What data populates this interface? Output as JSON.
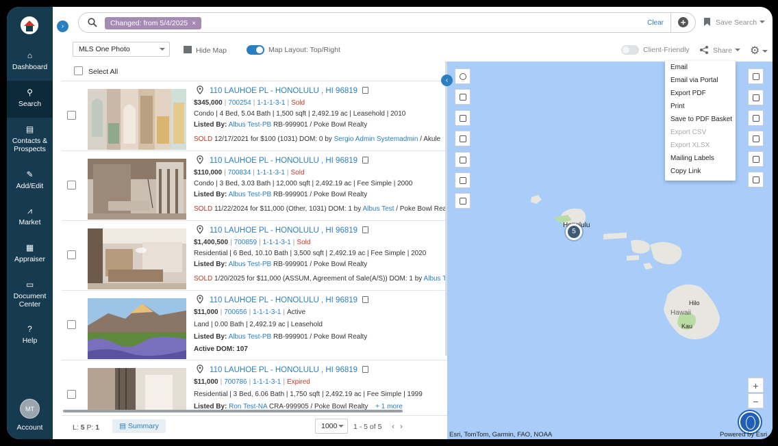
{
  "sidebar": {
    "items": [
      {
        "label": "Dashboard",
        "icon": "home-icon"
      },
      {
        "label": "Search",
        "icon": "search-icon"
      },
      {
        "label": "Contacts & Prospects",
        "icon": "contact-card-icon"
      },
      {
        "label": "Add/Edit",
        "icon": "edit-icon"
      },
      {
        "label": "Market",
        "icon": "chart-icon"
      },
      {
        "label": "Appraiser",
        "icon": "calculator-icon"
      },
      {
        "label": "Document Center",
        "icon": "folder-icon"
      },
      {
        "label": "Help",
        "icon": "help-icon"
      }
    ],
    "account_initials": "MT",
    "account_label": "Account"
  },
  "search": {
    "chip": "Changed: from 5/4/2025",
    "clear": "Clear",
    "save_search": "Save Search"
  },
  "toolbar": {
    "view_select": "MLS One Photo",
    "hide_map": "Hide Map",
    "map_layout": "Map Layout: Top/Right",
    "client_friendly": "Client-Friendly",
    "share": "Share"
  },
  "list": {
    "select_all": "Select All",
    "rows": [
      {
        "address": "110 LAUHOE PL - HONOLULU , HI 96819",
        "price": "$345,000",
        "mls": "700254",
        "tmk": "1-1-1-3-1",
        "status": "Sold",
        "details": "Condo | 4  Bed, 5.04 Bath | 1,500 sqft | 2,492.19 ac | Leasehold | 2010",
        "listed_by_label": "Listed By:",
        "agent": "Albus Test-PB",
        "agent_rest": "RB-999901 / Poke Bowl Realty",
        "sold_label": "SOLD",
        "sold_rest": "12/17/2021 for $100 (1031) DOM: 0 by",
        "buyer_agent": "Sergio Admin Systemadmin",
        "buyer_rest": "/ Akule"
      },
      {
        "address": "110 LAUHOE PL - HONOLULU , HI 96819",
        "price": "$110,000",
        "mls": "700834",
        "tmk": "1-1-1-3-1",
        "status": "Sold",
        "details": "Condo | 3  Bed, 3.03 Bath | 12,000 sqft | 2,492.19 ac | Fee Simple | 2000",
        "listed_by_label": "Listed By:",
        "agent": "Albus Test-PB",
        "agent_rest": "RB-999901 / Poke Bowl Realty",
        "sold_label": "SOLD",
        "sold_rest": "11/22/2024 for $11,000 (Other, 1031) DOM: 1 by",
        "buyer_agent": "Albus Test",
        "buyer_rest": "/ Poke Bowl Rea"
      },
      {
        "address": "110 LAUHOE PL - HONOLULU , HI 96819",
        "price": "$1,400,500",
        "mls": "700859",
        "tmk": "1-1-1-3-1",
        "status": "Sold",
        "details": "Residential | 6  Bed, 10.10 Bath | 3,500 sqft | 2,492.19 ac | Fee Simple | 2020",
        "listed_by_label": "Listed By:",
        "agent": "Albus Test-PB",
        "agent_rest": "RB-999901 / Poke Bowl Realty",
        "sold_label": "SOLD",
        "sold_rest": "1/20/2025 for $11,000 (ASSUM, Agreement of Sale(A/S)) DOM: 1 by",
        "buyer_agent": "Albus T",
        "buyer_rest": ""
      },
      {
        "address": "110 LAUHOE PL - HONOLULU , HI 96819",
        "price": "$11,000",
        "mls": "700656",
        "tmk": "1-1-1-3-1",
        "status": "Active",
        "details": "Land | 0.00 Bath | 2,492.19 ac | Leasehold",
        "listed_by_label": "Listed By:",
        "agent": "Albus Test-PB",
        "agent_rest": "RB-999901 / Poke Bowl Realty",
        "active_dom": "Active DOM: 107"
      },
      {
        "address": "110 LAUHOE PL - HONOLULU , HI 96819",
        "price": "$11,000",
        "mls": "700786",
        "tmk": "1-1-1-3-1",
        "status": "Expired",
        "details": "Residential | 3  Bed, 6.06 Bath | 1,750 sqft | 2,492.19 ac | Fee Simple | 1999",
        "listed_by_label": "Listed By:",
        "agent": "Ron Test-NA",
        "agent_rest": "CRA-999905 / Poke Bowl Realty",
        "more": "+ 1 more"
      }
    ]
  },
  "footer": {
    "l_label": "L:",
    "l_value": "5",
    "p_label": "P:",
    "p_value": "1",
    "summary": "Summary",
    "page_size": "1000",
    "range": "1 - 5  of 5"
  },
  "map": {
    "cluster_count": "5",
    "labels": {
      "honolulu": "Honolulu",
      "hilo": "Hilo",
      "hawaii": "Hawaii",
      "kau": "Kau"
    },
    "attribution_left": "Esri, TomTom, Garmin, FAO, NOAA",
    "attribution_right": "Powered by Esri",
    "zoom_in": "+",
    "zoom_out": "−"
  },
  "share_menu": {
    "items": [
      {
        "label": "Email",
        "enabled": true
      },
      {
        "label": "Email via Portal",
        "enabled": true
      },
      {
        "label": "Export PDF",
        "enabled": true
      },
      {
        "label": "Print",
        "enabled": true
      },
      {
        "label": "Save to PDF Basket",
        "enabled": true
      },
      {
        "label": "Export CSV",
        "enabled": false
      },
      {
        "label": "Export XLSX",
        "enabled": false
      },
      {
        "label": "Mailing Labels",
        "enabled": true
      },
      {
        "label": "Copy Link",
        "enabled": true
      }
    ]
  },
  "colors": {
    "sidebar": "#163a4f",
    "accent": "#2a7fc1",
    "sold": "#c0392b",
    "chip": "#a58ab3",
    "water": "#a9cdf8"
  }
}
